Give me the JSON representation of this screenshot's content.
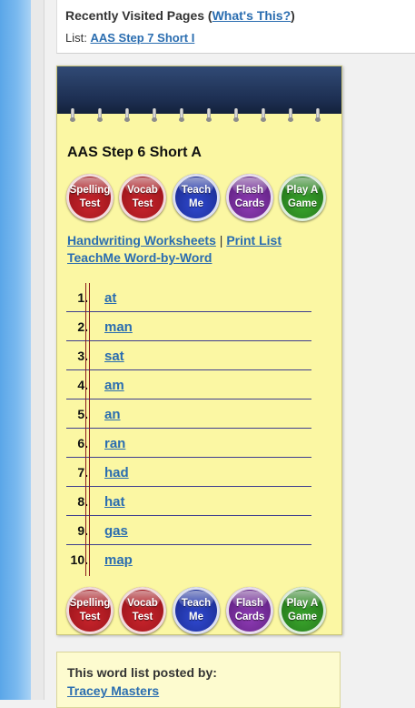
{
  "recent": {
    "title_prefix": "Recently Visited Pages (",
    "whats_this": "What's This?",
    "title_suffix": ")",
    "list_label": "List: ",
    "list_link": "AAS Step 7 Short I"
  },
  "pad": {
    "title": "AAS Step 6 Short A",
    "buttons": [
      {
        "line1": "Spelling",
        "line2": "Test",
        "color": "#b3161d"
      },
      {
        "line1": "Vocab",
        "line2": "Test",
        "color": "#b3161d"
      },
      {
        "line1": "Teach",
        "line2": "Me",
        "color": "#2236b8"
      },
      {
        "line1": "Flash",
        "line2": "Cards",
        "color": "#7a2aa0"
      },
      {
        "line1": "Play A",
        "line2": "Game",
        "color": "#2e8f22"
      }
    ],
    "handwriting_link": "Handwriting Worksheets",
    "separator": " | ",
    "print_link": "Print List",
    "teachme_link": "TeachMe Word-by-Word"
  },
  "words": [
    {
      "num": "1.",
      "word": "at"
    },
    {
      "num": "2.",
      "word": "man"
    },
    {
      "num": "3.",
      "word": "sat"
    },
    {
      "num": "4.",
      "word": "am"
    },
    {
      "num": "5.",
      "word": "an"
    },
    {
      "num": "6.",
      "word": "ran"
    },
    {
      "num": "7.",
      "word": "had"
    },
    {
      "num": "8.",
      "word": "hat"
    },
    {
      "num": "9.",
      "word": "gas"
    },
    {
      "num": "10.",
      "word": "map"
    }
  ],
  "posted": {
    "label": "This word list posted by:",
    "name": "Tracey Masters"
  },
  "colors": {
    "link": "#2a6db0",
    "pad_bg": "#fbf7a3",
    "pad_header": "#1d2f52",
    "sidebar_blue": "#6fb3ec"
  }
}
